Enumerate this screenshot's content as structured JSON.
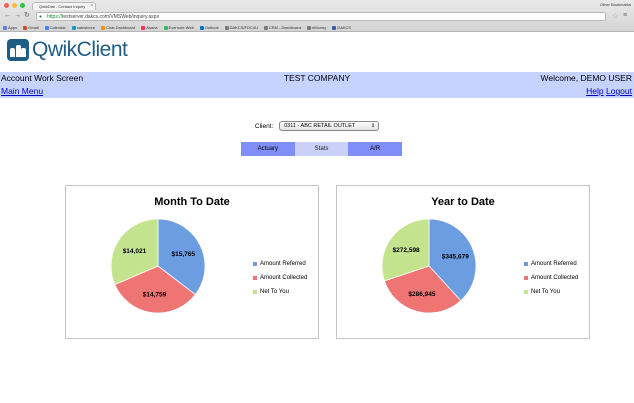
{
  "browser": {
    "tab_title": "QwikDial - Contact Inquiry",
    "url_scheme": "https://",
    "url_rest": "testserver.dakcs.com/VMSWeb/inquiry.aspx",
    "bookmarks": [
      {
        "label": "Apps",
        "color": "#5b7fd6"
      },
      {
        "label": "Gmail",
        "color": "#d44638"
      },
      {
        "label": "Calendar",
        "color": "#4285f4"
      },
      {
        "label": "salesforce",
        "color": "#1798c1"
      },
      {
        "label": "Chat Dashboard",
        "color": "#f29900"
      },
      {
        "label": "Asana",
        "color": "#e8384f"
      },
      {
        "label": "Evernote Web",
        "color": "#2dbe60"
      },
      {
        "label": "Outlook",
        "color": "#0072c6"
      },
      {
        "label": "DAKCS/FDC4U",
        "color": "#7a7a7a"
      },
      {
        "label": "CRM - Dashboard",
        "color": "#7a7a7a"
      },
      {
        "label": "eMoney",
        "color": "#7a7a7a"
      },
      {
        "label": "DAKCS",
        "color": "#3a5ca8"
      }
    ],
    "other_bookmarks": "Other Bookmarks"
  },
  "app": {
    "logo_text": "QwikClient",
    "brand_color": "#1f5d84"
  },
  "header": {
    "screen_name": "Account Work Screen",
    "company": "TEST COMPANY",
    "welcome": "Welcome, DEMO USER",
    "main_menu": "Main Menu",
    "help": "Help",
    "logout": "Logout"
  },
  "client": {
    "label": "Client:",
    "selected": "0311 - ABC RETAIL OUTLET"
  },
  "tabs": [
    {
      "label": "Actuary"
    },
    {
      "label": "Stats"
    },
    {
      "label": "A/R"
    }
  ],
  "chart_data": [
    {
      "type": "pie",
      "title": "Month To Date",
      "labels": [
        "Amount Referred",
        "Amount Collected",
        "Net To You"
      ],
      "values": [
        15765,
        14759,
        14021
      ],
      "display_labels": [
        "$15,765",
        "$14,759",
        "$14,021"
      ],
      "colors": [
        "#6b9de0",
        "#ef7575",
        "#c4e38f"
      ],
      "legend": "right"
    },
    {
      "type": "pie",
      "title": "Year to Date",
      "labels": [
        "Amount Referred",
        "Amount Collected",
        "Net To You"
      ],
      "values": [
        345679,
        286945,
        272598
      ],
      "display_labels": [
        "$345,679",
        "$286,945",
        "$272,598"
      ],
      "colors": [
        "#6b9de0",
        "#ef7575",
        "#c4e38f"
      ],
      "legend": "right"
    }
  ]
}
